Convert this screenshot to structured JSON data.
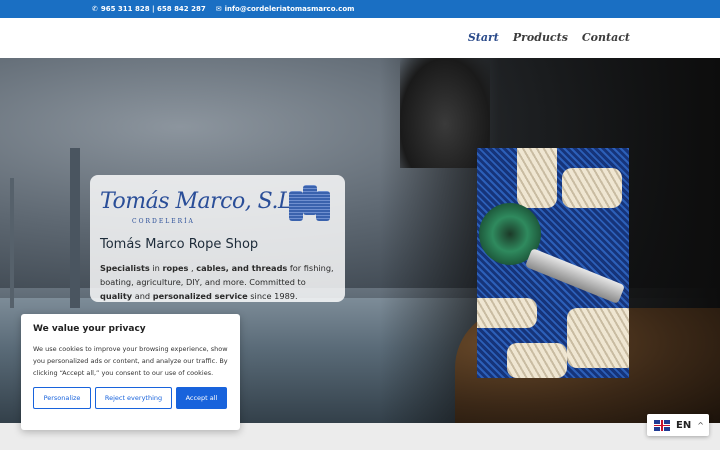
{
  "topbar": {
    "phone_icon": "phone-icon",
    "phones": "965 311 828 | 658 842 287",
    "email_icon": "mail-icon",
    "email": "info@cordeleriatomasmarco.com"
  },
  "nav": {
    "items": [
      "Start",
      "Products",
      "Contact"
    ],
    "active": "Start"
  },
  "card": {
    "logo_text": "Tomás Marco, S.L.",
    "logo_sub": "CORDELERÍA",
    "title": "Tomás Marco Rope Shop",
    "desc_parts": {
      "p1": "Specialists",
      "p2": " in ",
      "p3": "ropes",
      "p4": " , ",
      "p5": "cables, and threads",
      "p6": " for fishing, boating, agriculture, DIY, and more. Committed to ",
      "p7": "quality",
      "p8": " and ",
      "p9": "personalized service",
      "p10": " since 1989."
    }
  },
  "cookie": {
    "title": "We value your privacy",
    "text": "We use cookies to improve your browsing experience, show you personalized ads or content, and analyze our traffic. By clicking “Accept all,” you consent to our use of cookies.",
    "customize": "Personalize",
    "reject": "Reject everything",
    "accept": "Accept all"
  },
  "lang": {
    "code": "EN",
    "caret": "^"
  },
  "colors": {
    "topbar": "#1a6fc3",
    "accent": "#1863dc",
    "logo": "#2a4e98"
  }
}
